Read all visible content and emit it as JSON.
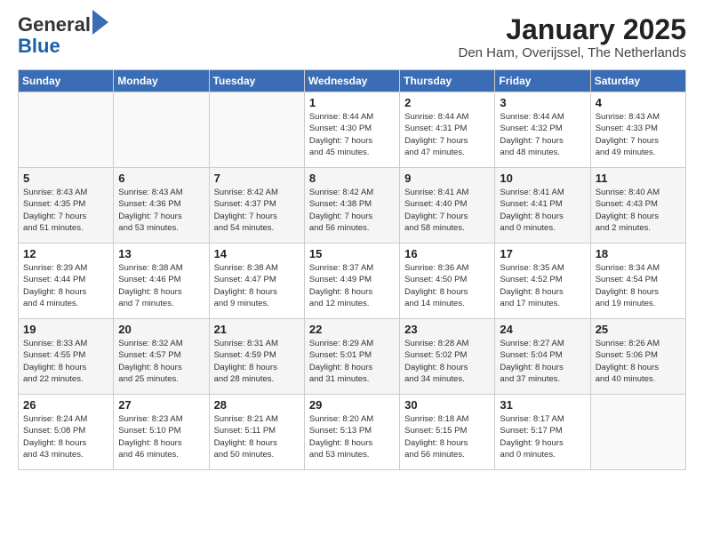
{
  "logo": {
    "general": "General",
    "blue": "Blue"
  },
  "title": "January 2025",
  "subtitle": "Den Ham, Overijssel, The Netherlands",
  "days_of_week": [
    "Sunday",
    "Monday",
    "Tuesday",
    "Wednesday",
    "Thursday",
    "Friday",
    "Saturday"
  ],
  "weeks": [
    [
      {
        "day": "",
        "info": ""
      },
      {
        "day": "",
        "info": ""
      },
      {
        "day": "",
        "info": ""
      },
      {
        "day": "1",
        "info": "Sunrise: 8:44 AM\nSunset: 4:30 PM\nDaylight: 7 hours\nand 45 minutes."
      },
      {
        "day": "2",
        "info": "Sunrise: 8:44 AM\nSunset: 4:31 PM\nDaylight: 7 hours\nand 47 minutes."
      },
      {
        "day": "3",
        "info": "Sunrise: 8:44 AM\nSunset: 4:32 PM\nDaylight: 7 hours\nand 48 minutes."
      },
      {
        "day": "4",
        "info": "Sunrise: 8:43 AM\nSunset: 4:33 PM\nDaylight: 7 hours\nand 49 minutes."
      }
    ],
    [
      {
        "day": "5",
        "info": "Sunrise: 8:43 AM\nSunset: 4:35 PM\nDaylight: 7 hours\nand 51 minutes."
      },
      {
        "day": "6",
        "info": "Sunrise: 8:43 AM\nSunset: 4:36 PM\nDaylight: 7 hours\nand 53 minutes."
      },
      {
        "day": "7",
        "info": "Sunrise: 8:42 AM\nSunset: 4:37 PM\nDaylight: 7 hours\nand 54 minutes."
      },
      {
        "day": "8",
        "info": "Sunrise: 8:42 AM\nSunset: 4:38 PM\nDaylight: 7 hours\nand 56 minutes."
      },
      {
        "day": "9",
        "info": "Sunrise: 8:41 AM\nSunset: 4:40 PM\nDaylight: 7 hours\nand 58 minutes."
      },
      {
        "day": "10",
        "info": "Sunrise: 8:41 AM\nSunset: 4:41 PM\nDaylight: 8 hours\nand 0 minutes."
      },
      {
        "day": "11",
        "info": "Sunrise: 8:40 AM\nSunset: 4:43 PM\nDaylight: 8 hours\nand 2 minutes."
      }
    ],
    [
      {
        "day": "12",
        "info": "Sunrise: 8:39 AM\nSunset: 4:44 PM\nDaylight: 8 hours\nand 4 minutes."
      },
      {
        "day": "13",
        "info": "Sunrise: 8:38 AM\nSunset: 4:46 PM\nDaylight: 8 hours\nand 7 minutes."
      },
      {
        "day": "14",
        "info": "Sunrise: 8:38 AM\nSunset: 4:47 PM\nDaylight: 8 hours\nand 9 minutes."
      },
      {
        "day": "15",
        "info": "Sunrise: 8:37 AM\nSunset: 4:49 PM\nDaylight: 8 hours\nand 12 minutes."
      },
      {
        "day": "16",
        "info": "Sunrise: 8:36 AM\nSunset: 4:50 PM\nDaylight: 8 hours\nand 14 minutes."
      },
      {
        "day": "17",
        "info": "Sunrise: 8:35 AM\nSunset: 4:52 PM\nDaylight: 8 hours\nand 17 minutes."
      },
      {
        "day": "18",
        "info": "Sunrise: 8:34 AM\nSunset: 4:54 PM\nDaylight: 8 hours\nand 19 minutes."
      }
    ],
    [
      {
        "day": "19",
        "info": "Sunrise: 8:33 AM\nSunset: 4:55 PM\nDaylight: 8 hours\nand 22 minutes."
      },
      {
        "day": "20",
        "info": "Sunrise: 8:32 AM\nSunset: 4:57 PM\nDaylight: 8 hours\nand 25 minutes."
      },
      {
        "day": "21",
        "info": "Sunrise: 8:31 AM\nSunset: 4:59 PM\nDaylight: 8 hours\nand 28 minutes."
      },
      {
        "day": "22",
        "info": "Sunrise: 8:29 AM\nSunset: 5:01 PM\nDaylight: 8 hours\nand 31 minutes."
      },
      {
        "day": "23",
        "info": "Sunrise: 8:28 AM\nSunset: 5:02 PM\nDaylight: 8 hours\nand 34 minutes."
      },
      {
        "day": "24",
        "info": "Sunrise: 8:27 AM\nSunset: 5:04 PM\nDaylight: 8 hours\nand 37 minutes."
      },
      {
        "day": "25",
        "info": "Sunrise: 8:26 AM\nSunset: 5:06 PM\nDaylight: 8 hours\nand 40 minutes."
      }
    ],
    [
      {
        "day": "26",
        "info": "Sunrise: 8:24 AM\nSunset: 5:08 PM\nDaylight: 8 hours\nand 43 minutes."
      },
      {
        "day": "27",
        "info": "Sunrise: 8:23 AM\nSunset: 5:10 PM\nDaylight: 8 hours\nand 46 minutes."
      },
      {
        "day": "28",
        "info": "Sunrise: 8:21 AM\nSunset: 5:11 PM\nDaylight: 8 hours\nand 50 minutes."
      },
      {
        "day": "29",
        "info": "Sunrise: 8:20 AM\nSunset: 5:13 PM\nDaylight: 8 hours\nand 53 minutes."
      },
      {
        "day": "30",
        "info": "Sunrise: 8:18 AM\nSunset: 5:15 PM\nDaylight: 8 hours\nand 56 minutes."
      },
      {
        "day": "31",
        "info": "Sunrise: 8:17 AM\nSunset: 5:17 PM\nDaylight: 9 hours\nand 0 minutes."
      },
      {
        "day": "",
        "info": ""
      }
    ]
  ]
}
